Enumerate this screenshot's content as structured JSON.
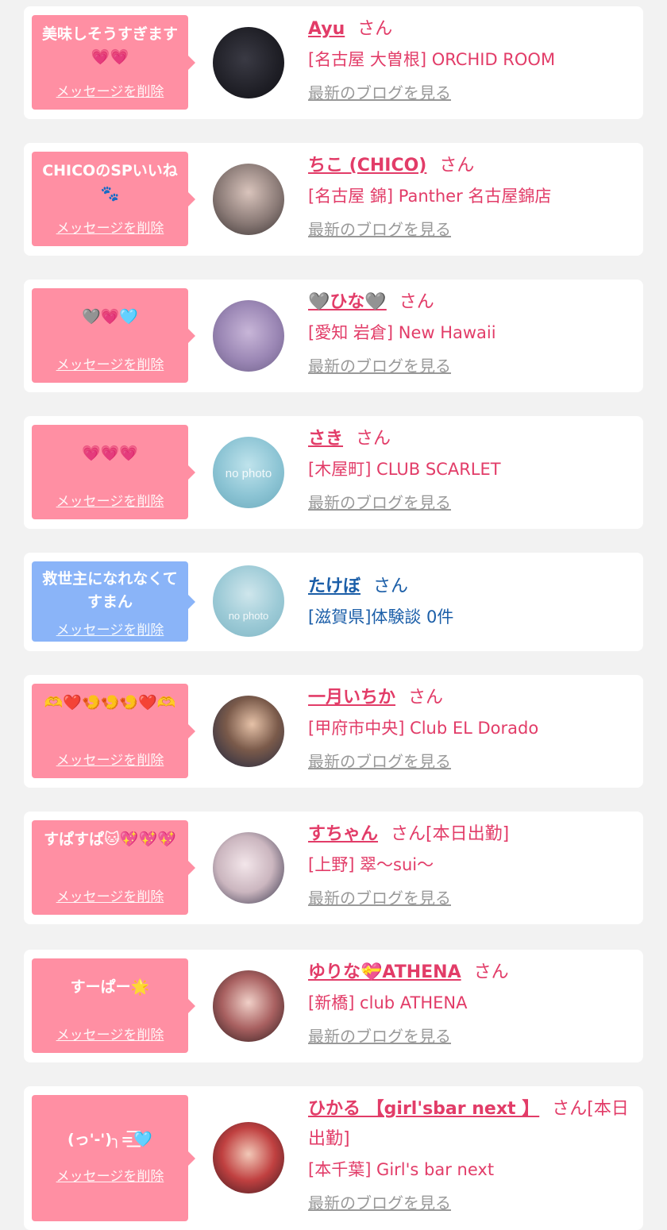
{
  "entries": [
    {
      "message": "美味しそうすぎます💗💗",
      "delete_label": "メッセージを削除",
      "name": "Ayu",
      "san": "さん",
      "shop": "[名古屋 大曽根] ORCHID ROOM",
      "blog_link": "最新のブログを見る"
    },
    {
      "message": "CHICOのSPいいね🐾",
      "delete_label": "メッセージを削除",
      "name": "ちこ (CHICO)",
      "san": "さん",
      "shop": "[名古屋 錦] Panther 名古屋錦店",
      "blog_link": "最新のブログを見る"
    },
    {
      "message": "🩶💗🩵",
      "delete_label": "メッセージを削除",
      "name": "🩶ひな🩶",
      "san": "さん",
      "shop": "[愛知 岩倉] New Hawaii",
      "blog_link": "最新のブログを見る"
    },
    {
      "message": "💗💗💗",
      "delete_label": "メッセージを削除",
      "name": "さき",
      "san": "さん",
      "shop": "[木屋町] CLUB SCARLET",
      "blog_link": "最新のブログを見る",
      "avatar_text": "no photo"
    },
    {
      "message": "救世主になれなくてすまん",
      "delete_label": "メッセージを削除",
      "name": "たけぼ",
      "san": "さん",
      "shop": "[滋賀県]体験談 0件",
      "avatar_text": "no photo"
    },
    {
      "message": "🫶❤️🍤🍤🍤❤️🫶",
      "delete_label": "メッセージを削除",
      "name": "一月いちか",
      "san": "さん",
      "shop": "[甲府市中央] Club EL Dorado",
      "blog_link": "最新のブログを見る"
    },
    {
      "message": "すぱすぱ🐱💖💖💖",
      "delete_label": "メッセージを削除",
      "name": "すちゃん",
      "san": "さん[本日出勤]",
      "shop": "[上野] 翠〜sui〜",
      "blog_link": "最新のブログを見る"
    },
    {
      "message": "すーぱー🌟",
      "delete_label": "メッセージを削除",
      "name": "ゆりな💝ATHENA",
      "san": "さん",
      "shop": "[新橋] club ATHENA",
      "blog_link": "最新のブログを見る"
    },
    {
      "message": "(っ'-')╮=͟͟͞͞🩵",
      "delete_label": "メッセージを削除",
      "name": "ひかる 【girl'sbar next 】",
      "san": "さん[本日出勤]",
      "shop": "[本千葉] Girl's bar next",
      "blog_link": "最新のブログを見る"
    }
  ],
  "colors": {
    "background": "#f2f2f2",
    "card": "#ffffff",
    "bubble_pink": "#ff8fa3",
    "bubble_blue": "#8ab4f8",
    "name_pink": "#e23c68",
    "name_blue": "#1b5ea8",
    "link_gray": "#999999"
  }
}
